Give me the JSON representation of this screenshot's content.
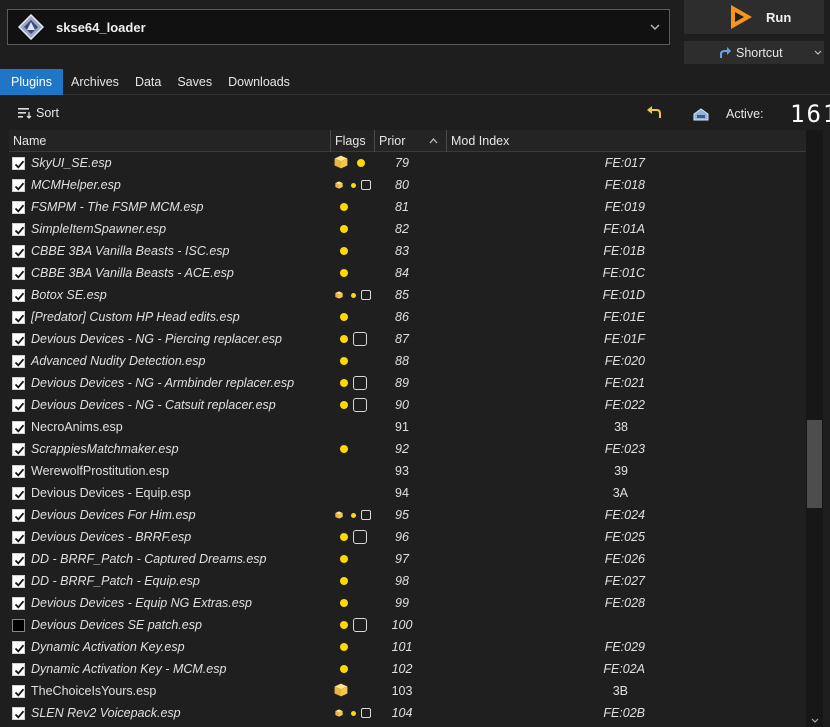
{
  "executable": {
    "name": "skse64_loader",
    "icon": "skse-diamond-icon"
  },
  "run_button": {
    "label": "Run",
    "icon": "play-icon",
    "accent": "#f7941d"
  },
  "shortcut_button": {
    "label": "Shortcut",
    "icon": "shortcut-arrow-icon"
  },
  "tabs": [
    {
      "label": "Plugins",
      "active": true
    },
    {
      "label": "Archives",
      "active": false
    },
    {
      "label": "Data",
      "active": false
    },
    {
      "label": "Saves",
      "active": false
    },
    {
      "label": "Downloads",
      "active": false
    }
  ],
  "toolbar": {
    "sort_label": "Sort",
    "active_label": "Active:",
    "active_count": "161",
    "undo_icon": "undo-icon",
    "backup_icon": "backup-icon"
  },
  "columns": {
    "name": "Name",
    "flags": "Flags",
    "priority": "Prior",
    "mod_index": "Mod Index"
  },
  "colors": {
    "accent": "#1f76c7",
    "flag_dot": "#ffd800"
  },
  "plugins": [
    {
      "checked": true,
      "name": "SkyUI_SE.esp",
      "italic": true,
      "flags": "pkg-dot",
      "priority": "79",
      "mod_index": "FE:017"
    },
    {
      "checked": true,
      "name": "MCMHelper.esp",
      "italic": true,
      "flags": "pkg-dot-box",
      "priority": "80",
      "mod_index": "FE:018"
    },
    {
      "checked": true,
      "name": "FSMPM - The FSMP MCM.esp",
      "italic": true,
      "flags": "dot",
      "priority": "81",
      "mod_index": "FE:019"
    },
    {
      "checked": true,
      "name": "SimpleItemSpawner.esp",
      "italic": true,
      "flags": "dot",
      "priority": "82",
      "mod_index": "FE:01A"
    },
    {
      "checked": true,
      "name": "CBBE 3BA Vanilla Beasts - ISC.esp",
      "italic": true,
      "flags": "dot",
      "priority": "83",
      "mod_index": "FE:01B"
    },
    {
      "checked": true,
      "name": "CBBE 3BA Vanilla Beasts - ACE.esp",
      "italic": true,
      "flags": "dot",
      "priority": "84",
      "mod_index": "FE:01C"
    },
    {
      "checked": true,
      "name": "Botox SE.esp",
      "italic": true,
      "flags": "pkg-dot-box",
      "priority": "85",
      "mod_index": "FE:01D"
    },
    {
      "checked": true,
      "name": "[Predator] Custom HP Head edits.esp",
      "italic": true,
      "flags": "dot",
      "priority": "86",
      "mod_index": "FE:01E"
    },
    {
      "checked": true,
      "name": "Devious Devices - NG - Piercing replacer.esp",
      "italic": true,
      "flags": "dot-bigbox",
      "priority": "87",
      "mod_index": "FE:01F"
    },
    {
      "checked": true,
      "name": "Advanced Nudity Detection.esp",
      "italic": true,
      "flags": "dot",
      "priority": "88",
      "mod_index": "FE:020"
    },
    {
      "checked": true,
      "name": "Devious Devices - NG - Armbinder replacer.esp",
      "italic": true,
      "flags": "dot-bigbox",
      "priority": "89",
      "mod_index": "FE:021"
    },
    {
      "checked": true,
      "name": "Devious Devices - NG - Catsuit replacer.esp",
      "italic": true,
      "flags": "dot-bigbox",
      "priority": "90",
      "mod_index": "FE:022"
    },
    {
      "checked": true,
      "name": "NecroAnims.esp",
      "italic": false,
      "flags": "",
      "priority": "91",
      "mod_index": "38"
    },
    {
      "checked": true,
      "name": "ScrappiesMatchmaker.esp",
      "italic": true,
      "flags": "dot",
      "priority": "92",
      "mod_index": "FE:023"
    },
    {
      "checked": true,
      "name": "WerewolfProstitution.esp",
      "italic": false,
      "flags": "",
      "priority": "93",
      "mod_index": "39"
    },
    {
      "checked": true,
      "name": "Devious Devices - Equip.esp",
      "italic": false,
      "flags": "",
      "priority": "94",
      "mod_index": "3A"
    },
    {
      "checked": true,
      "name": "Devious Devices For Him.esp",
      "italic": true,
      "flags": "pkg-dot-box",
      "priority": "95",
      "mod_index": "FE:024"
    },
    {
      "checked": true,
      "name": "Devious Devices - BRRF.esp",
      "italic": true,
      "flags": "dot-bigbox",
      "priority": "96",
      "mod_index": "FE:025"
    },
    {
      "checked": true,
      "name": "DD - BRRF_Patch - Captured Dreams.esp",
      "italic": true,
      "flags": "dot",
      "priority": "97",
      "mod_index": "FE:026"
    },
    {
      "checked": true,
      "name": "DD - BRRF_Patch - Equip.esp",
      "italic": true,
      "flags": "dot",
      "priority": "98",
      "mod_index": "FE:027"
    },
    {
      "checked": true,
      "name": "Devious Devices - Equip NG Extras.esp",
      "italic": true,
      "flags": "dot",
      "priority": "99",
      "mod_index": "FE:028"
    },
    {
      "checked": false,
      "name": "Devious Devices SE patch.esp",
      "italic": true,
      "flags": "dot-bigbox",
      "priority": "100",
      "mod_index": ""
    },
    {
      "checked": true,
      "name": "Dynamic Activation Key.esp",
      "italic": true,
      "flags": "dot",
      "priority": "101",
      "mod_index": "FE:029"
    },
    {
      "checked": true,
      "name": "Dynamic Activation Key - MCM.esp",
      "italic": true,
      "flags": "dot",
      "priority": "102",
      "mod_index": "FE:02A"
    },
    {
      "checked": true,
      "name": "TheChoiceIsYours.esp",
      "italic": false,
      "flags": "pkg",
      "priority": "103",
      "mod_index": "3B"
    },
    {
      "checked": true,
      "name": "SLEN Rev2 Voicepack.esp",
      "italic": true,
      "flags": "pkg-dot-box",
      "priority": "104",
      "mod_index": "FE:02B"
    }
  ]
}
